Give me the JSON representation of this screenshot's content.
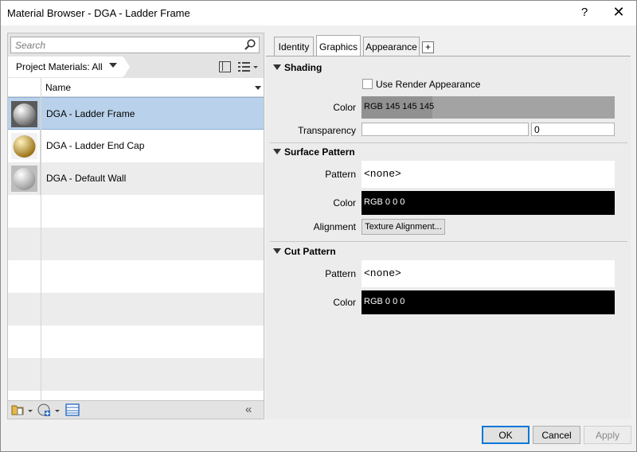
{
  "window": {
    "title": "Material Browser - DGA - Ladder Frame",
    "help": "?",
    "close": "✕"
  },
  "left": {
    "search_placeholder": "Search",
    "filter_label": "Project Materials: All",
    "column_name": "Name",
    "materials": [
      {
        "name": "DGA - Ladder Frame",
        "selected": true,
        "color": "#b8b8b8"
      },
      {
        "name": "DGA - Ladder End Cap",
        "selected": false,
        "color": "#d9b24a"
      },
      {
        "name": "DGA - Default Wall",
        "selected": false,
        "color": "#d8d8d8"
      }
    ],
    "collapse": "«"
  },
  "tabs": [
    "Identity",
    "Graphics",
    "Appearance"
  ],
  "tab_add": "+",
  "graphics": {
    "shading": {
      "header": "Shading",
      "use_render_label": "Use Render Appearance",
      "color_label": "Color",
      "color_value": "RGB 145 145 145",
      "color_hex": "#919191",
      "transparency_label": "Transparency",
      "transparency_value": "0"
    },
    "surface": {
      "header": "Surface Pattern",
      "pattern_label": "Pattern",
      "pattern_value": "<none>",
      "color_label": "Color",
      "color_value": "RGB 0 0 0",
      "alignment_label": "Alignment",
      "alignment_button": "Texture Alignment..."
    },
    "cut": {
      "header": "Cut Pattern",
      "pattern_label": "Pattern",
      "pattern_value": "<none>",
      "color_label": "Color",
      "color_value": "RGB 0 0 0"
    }
  },
  "footer": {
    "ok": "OK",
    "cancel": "Cancel",
    "apply": "Apply"
  }
}
